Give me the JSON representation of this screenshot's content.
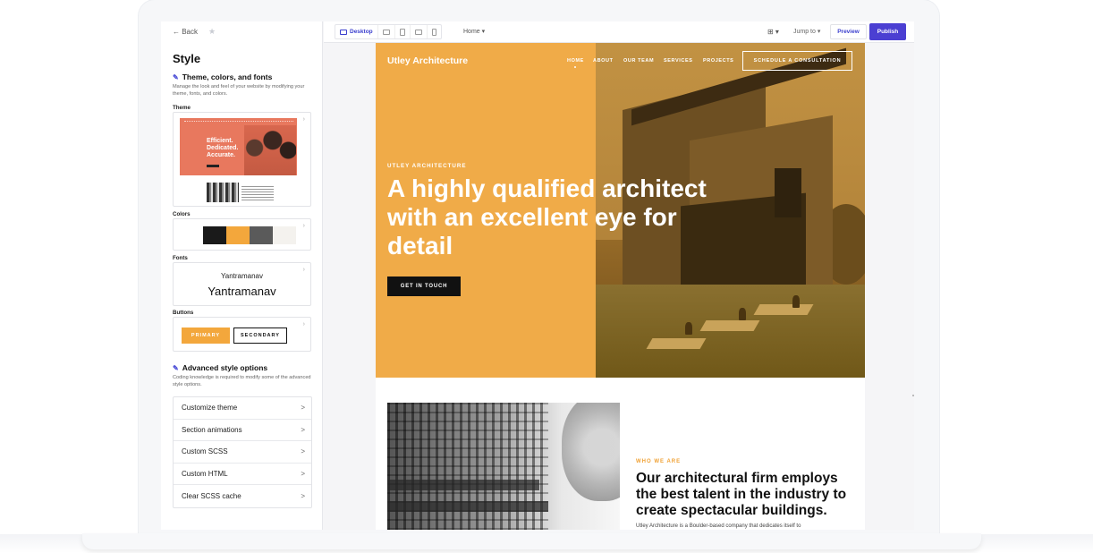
{
  "left_panel": {
    "back_label": "← Back",
    "pin_icon": "pin-icon",
    "title": "Style",
    "theme_section": {
      "heading": "Theme, colors, and fonts",
      "description": "Manage the look and feel of your website by modifying your theme, fonts, and colors."
    },
    "theme_label": "Theme",
    "theme_thumbnail_text": "Efficient. Dedicated. Accurate.",
    "colors_label": "Colors",
    "colors": [
      "#1a1a1a",
      "#f3a73c",
      "#5a5a5a",
      "#f4f2ee"
    ],
    "fonts_label": "Fonts",
    "font_name_small": "Yantramanav",
    "font_name_large": "Yantramanav",
    "buttons_label": "Buttons",
    "primary_button": "PRIMARY",
    "secondary_button": "SECONDARY",
    "advanced_section": {
      "heading": "Advanced style options",
      "description": "Coding knowledge is required to modify some of the advanced style options."
    },
    "advanced_items": [
      {
        "label": "Customize theme",
        "arrow": ">"
      },
      {
        "label": "Section animations",
        "arrow": ">"
      },
      {
        "label": "Custom SCSS",
        "arrow": ">"
      },
      {
        "label": "Custom HTML",
        "arrow": ">"
      },
      {
        "label": "Clear SCSS cache",
        "arrow": ">"
      }
    ]
  },
  "toolbar": {
    "device_active": "Desktop",
    "page_dropdown": "Home ▾",
    "layout_icon": "layout-icon",
    "jump_to": "Jump to ▾",
    "preview": "Preview",
    "publish": "Publish"
  },
  "site": {
    "logo": "Utley Architecture",
    "nav": [
      "HOME",
      "ABOUT",
      "OUR TEAM",
      "SERVICES",
      "PROJECTS"
    ],
    "cta": "SCHEDULE A CONSULTATION",
    "eyebrow": "UTLEY ARCHITECTURE",
    "headline": "A highly qualified architect with an excellent eye for detail",
    "touch_button": "GET IN TOUCH",
    "who_we_are": "WHO WE ARE",
    "about_heading": "Our architectural firm employs the best talent in the industry to create spectacular buildings.",
    "about_body": "Utley Architecture is a Boulder-based company that dedicates itself to",
    "accent_color": "#f0ab48"
  }
}
